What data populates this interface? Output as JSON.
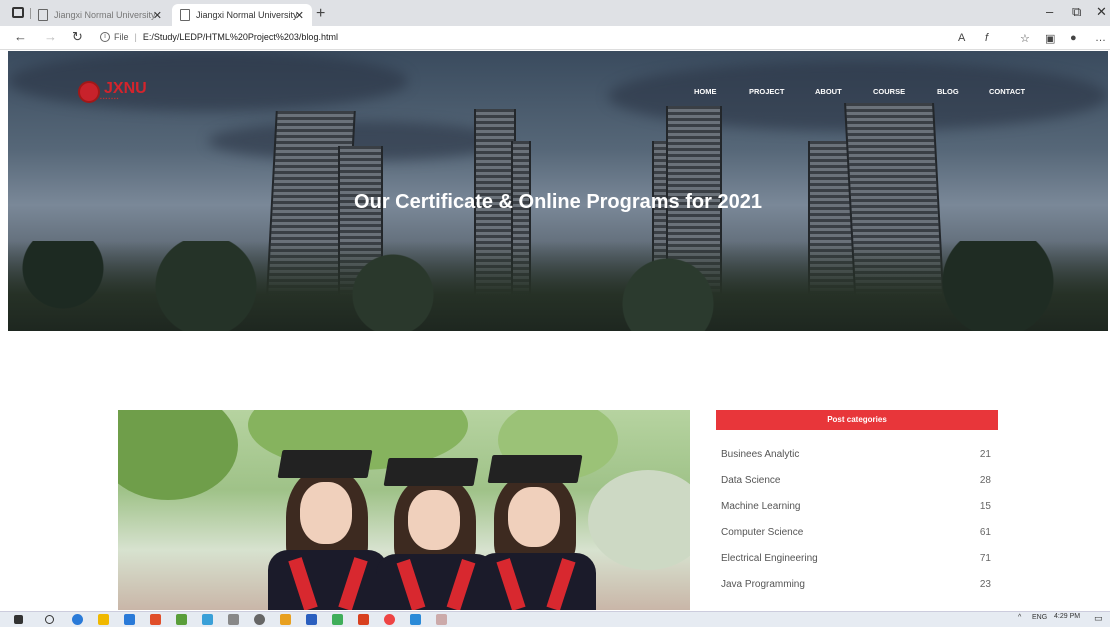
{
  "browser": {
    "tabs": [
      {
        "label": "Jiangxi Normal University",
        "active": false
      },
      {
        "label": "Jiangxi Normal University",
        "active": true
      }
    ],
    "url_prefix": "File",
    "url": "E:/Study/LEDP/HTML%20Project%203/blog.html"
  },
  "site": {
    "logo_text": "JXNU",
    "nav": [
      "HOME",
      "PROJECT",
      "ABOUT",
      "COURSE",
      "BLOG",
      "CONTACT"
    ],
    "hero_title": "Our Certificate & Online Programs for 2021"
  },
  "sidebar": {
    "header": "Post categories",
    "categories": [
      {
        "name": "Businees Analytic",
        "count": "21"
      },
      {
        "name": "Data Science",
        "count": "28"
      },
      {
        "name": "Machine Learning",
        "count": "15"
      },
      {
        "name": "Computer Science",
        "count": "61"
      },
      {
        "name": "Electrical Engineering",
        "count": "71"
      },
      {
        "name": "Java Programming",
        "count": "23"
      }
    ]
  },
  "taskbar": {
    "lang": "ENG",
    "time": "4:29 PM"
  },
  "colors": {
    "accent_red": "#e8363a",
    "logo_red": "#d4242c"
  }
}
